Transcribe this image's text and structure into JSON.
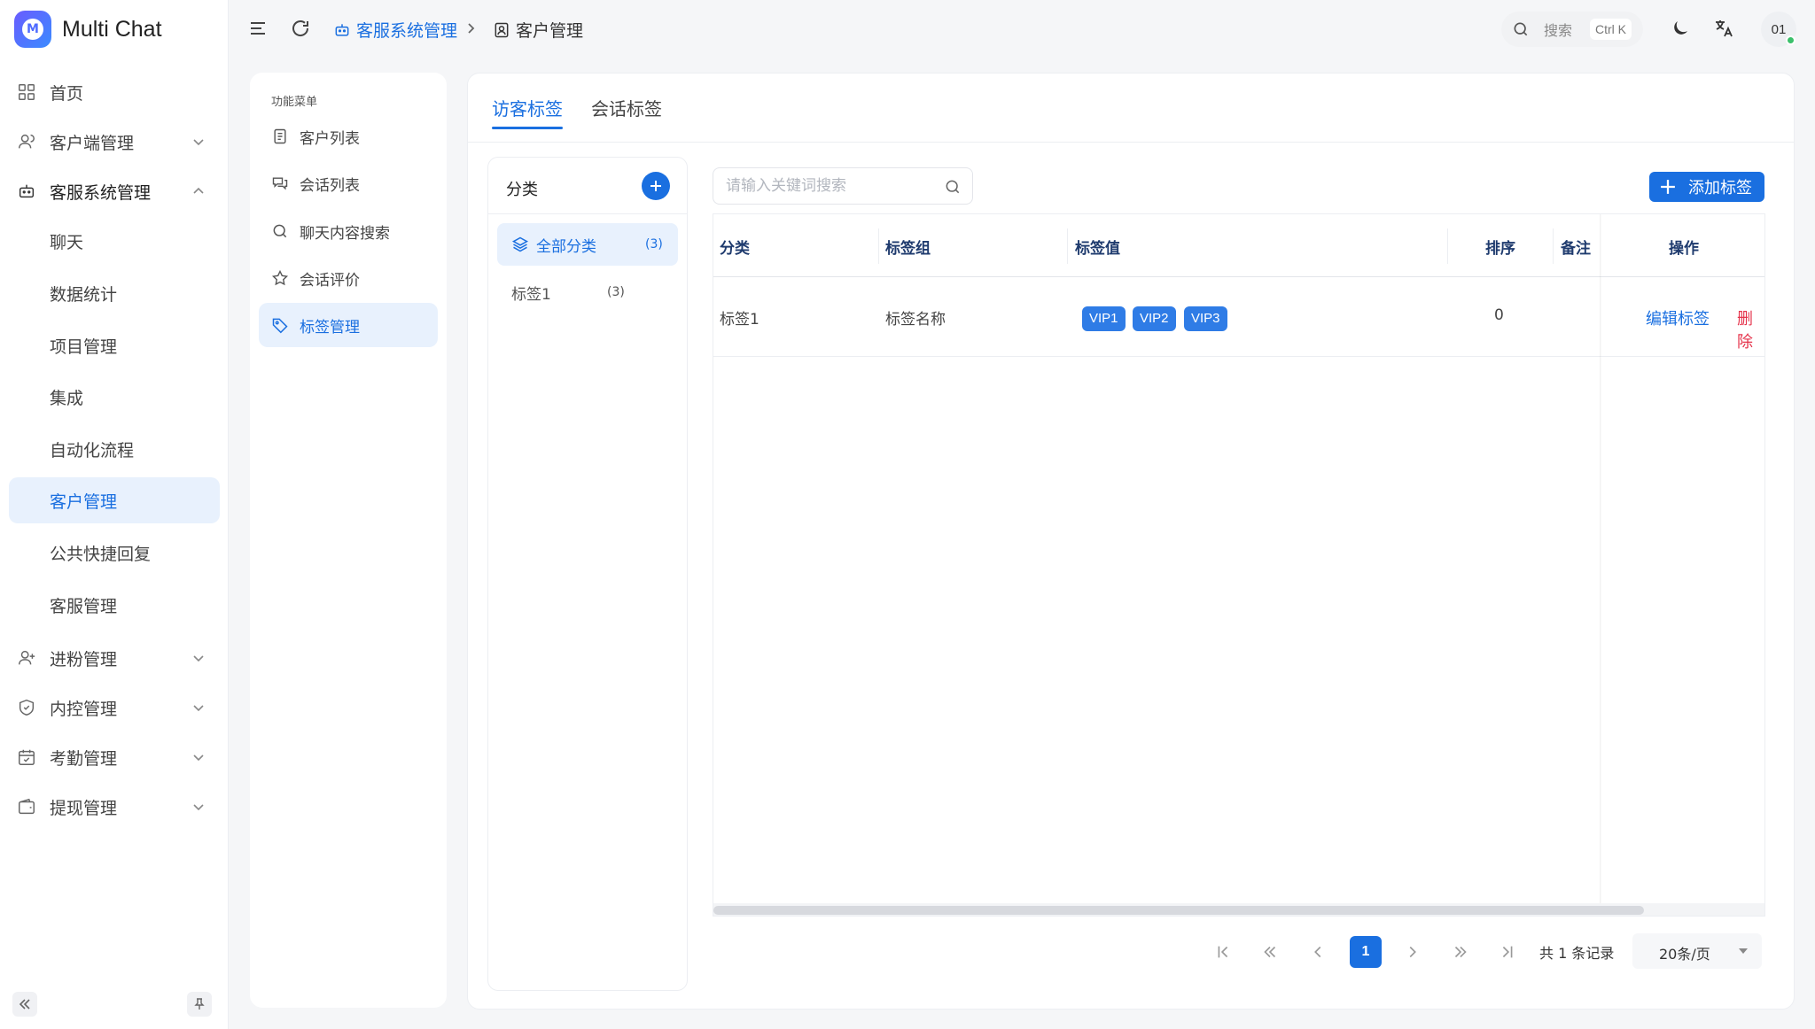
{
  "app": {
    "name": "Multi Chat",
    "logo_letter": "M"
  },
  "sidebar": {
    "items": [
      {
        "label": "首页",
        "icon": "dashboard-icon"
      },
      {
        "label": "客户端管理",
        "icon": "user-icon"
      },
      {
        "label": "客服系统管理",
        "icon": "robot-icon"
      },
      {
        "label": "聊天"
      },
      {
        "label": "数据统计"
      },
      {
        "label": "项目管理"
      },
      {
        "label": "集成"
      },
      {
        "label": "自动化流程"
      },
      {
        "label": "客户管理"
      },
      {
        "label": "公共快捷回复"
      },
      {
        "label": "客服管理"
      },
      {
        "label": "进粉管理",
        "icon": "user-plus-icon"
      },
      {
        "label": "内控管理",
        "icon": "shield-icon"
      },
      {
        "label": "考勤管理",
        "icon": "calendar-icon"
      },
      {
        "label": "提现管理",
        "icon": "wallet-icon"
      }
    ]
  },
  "header": {
    "breadcrumb": [
      "客服系统管理",
      "客户管理"
    ],
    "search_label": "搜索",
    "search_shortcut": "Ctrl K",
    "avatar_text": "01"
  },
  "func_menu": {
    "title": "功能菜单",
    "items": [
      {
        "label": "客户列表",
        "icon": "document-icon"
      },
      {
        "label": "会话列表",
        "icon": "chat-icon"
      },
      {
        "label": "聊天内容搜索",
        "icon": "search-icon"
      },
      {
        "label": "会话评价",
        "icon": "star-icon"
      },
      {
        "label": "标签管理",
        "icon": "tag-icon"
      }
    ]
  },
  "tabs": [
    "访客标签",
    "会话标签"
  ],
  "category": {
    "title": "分类",
    "items": [
      {
        "label": "全部分类",
        "count": "(3)"
      },
      {
        "label": "标签1",
        "count": "(3)"
      }
    ]
  },
  "toolbar": {
    "search_placeholder": "请输入关键词搜索",
    "add_label": "添加标签"
  },
  "table": {
    "headers": [
      "分类",
      "标签组",
      "标签值",
      "排序",
      "备注",
      "操作"
    ],
    "rows": [
      {
        "category": "标签1",
        "group": "标签名称",
        "values": [
          "VIP1",
          "VIP2",
          "VIP3"
        ],
        "sort": "0",
        "note": "",
        "edit": "编辑标签",
        "delete": "删除"
      }
    ]
  },
  "pagination": {
    "current": "1",
    "total": "共 1 条记录",
    "page_size": "20条/页"
  },
  "colors": {
    "accent": "#1a6fe0",
    "danger": "#e5334b",
    "tag": "#2f7ce6"
  }
}
